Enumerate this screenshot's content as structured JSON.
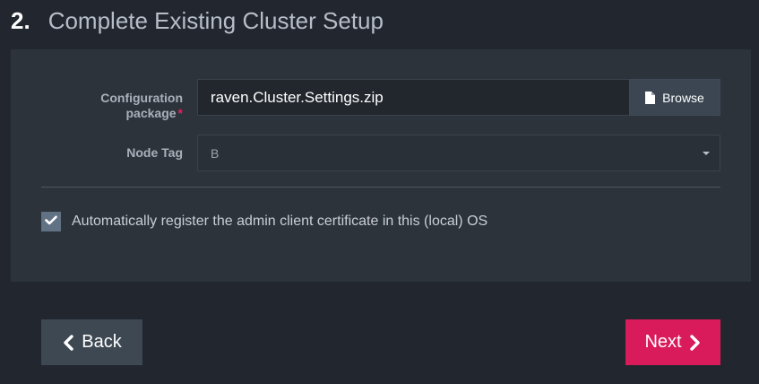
{
  "step": {
    "number": "2.",
    "title": "Complete Existing Cluster Setup"
  },
  "form": {
    "config_label_line1": "Configuration",
    "config_label_line2": "package",
    "required_mark": "*",
    "config_value": "raven.Cluster.Settings.zip",
    "browse_label": "Browse",
    "node_tag_label": "Node Tag",
    "node_tag_value": "B",
    "auto_register_label": "Automatically register the admin client certificate in this (local) OS",
    "auto_register_checked": true
  },
  "nav": {
    "back_label": "Back",
    "next_label": "Next"
  },
  "colors": {
    "background": "#22262f",
    "panel": "#2c333b",
    "accent": "#d91b5b",
    "required": "#e2225c"
  },
  "icons": {
    "browse": "file-icon",
    "node_select": "caret-down-icon",
    "checkbox": "check-icon",
    "back": "chevron-left-icon",
    "next": "chevron-right-icon"
  }
}
